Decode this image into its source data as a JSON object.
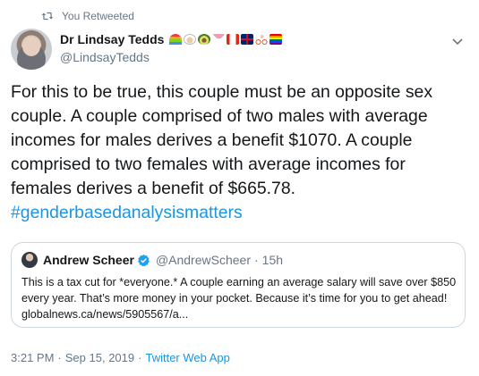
{
  "retweet": {
    "label": "You Retweeted",
    "icon": "retweet-icon"
  },
  "author": {
    "display_name": "Dr Lindsay Tedds",
    "handle": "@LindsayTedds",
    "name_emojis": [
      "rainbow",
      "health-worker",
      "avocado",
      "cocktail",
      "canada-flag",
      "uk-flag",
      "cyclist",
      "rainbow-flag"
    ]
  },
  "tweet": {
    "text": "For this to be true, this couple must be an opposite sex couple. A couple comprised of two males with average incomes for males derives a benefit $1070. A couple comprised to two females with average incomes for females derives a benefit of $665.78.",
    "hashtag": "#genderbasedanalysismatters"
  },
  "quoted": {
    "name": "Andrew Scheer",
    "handle": "@AndrewScheer",
    "separator": "·",
    "time": "15h",
    "text": "This is a tax cut for *everyone.* A couple earning an average salary will save over $850 every year. That’s more money in your pocket. Because it’s time for you to get ahead! globalnews.ca/news/5905567/a..."
  },
  "meta": {
    "time": "3:21 PM",
    "separator": "·",
    "date": "Sep 15, 2019",
    "separator2": "·",
    "source": "Twitter Web App"
  },
  "colors": {
    "link": "#1b95e0",
    "secondary": "#657786",
    "border": "#ccd6dd",
    "text": "#14171a"
  }
}
